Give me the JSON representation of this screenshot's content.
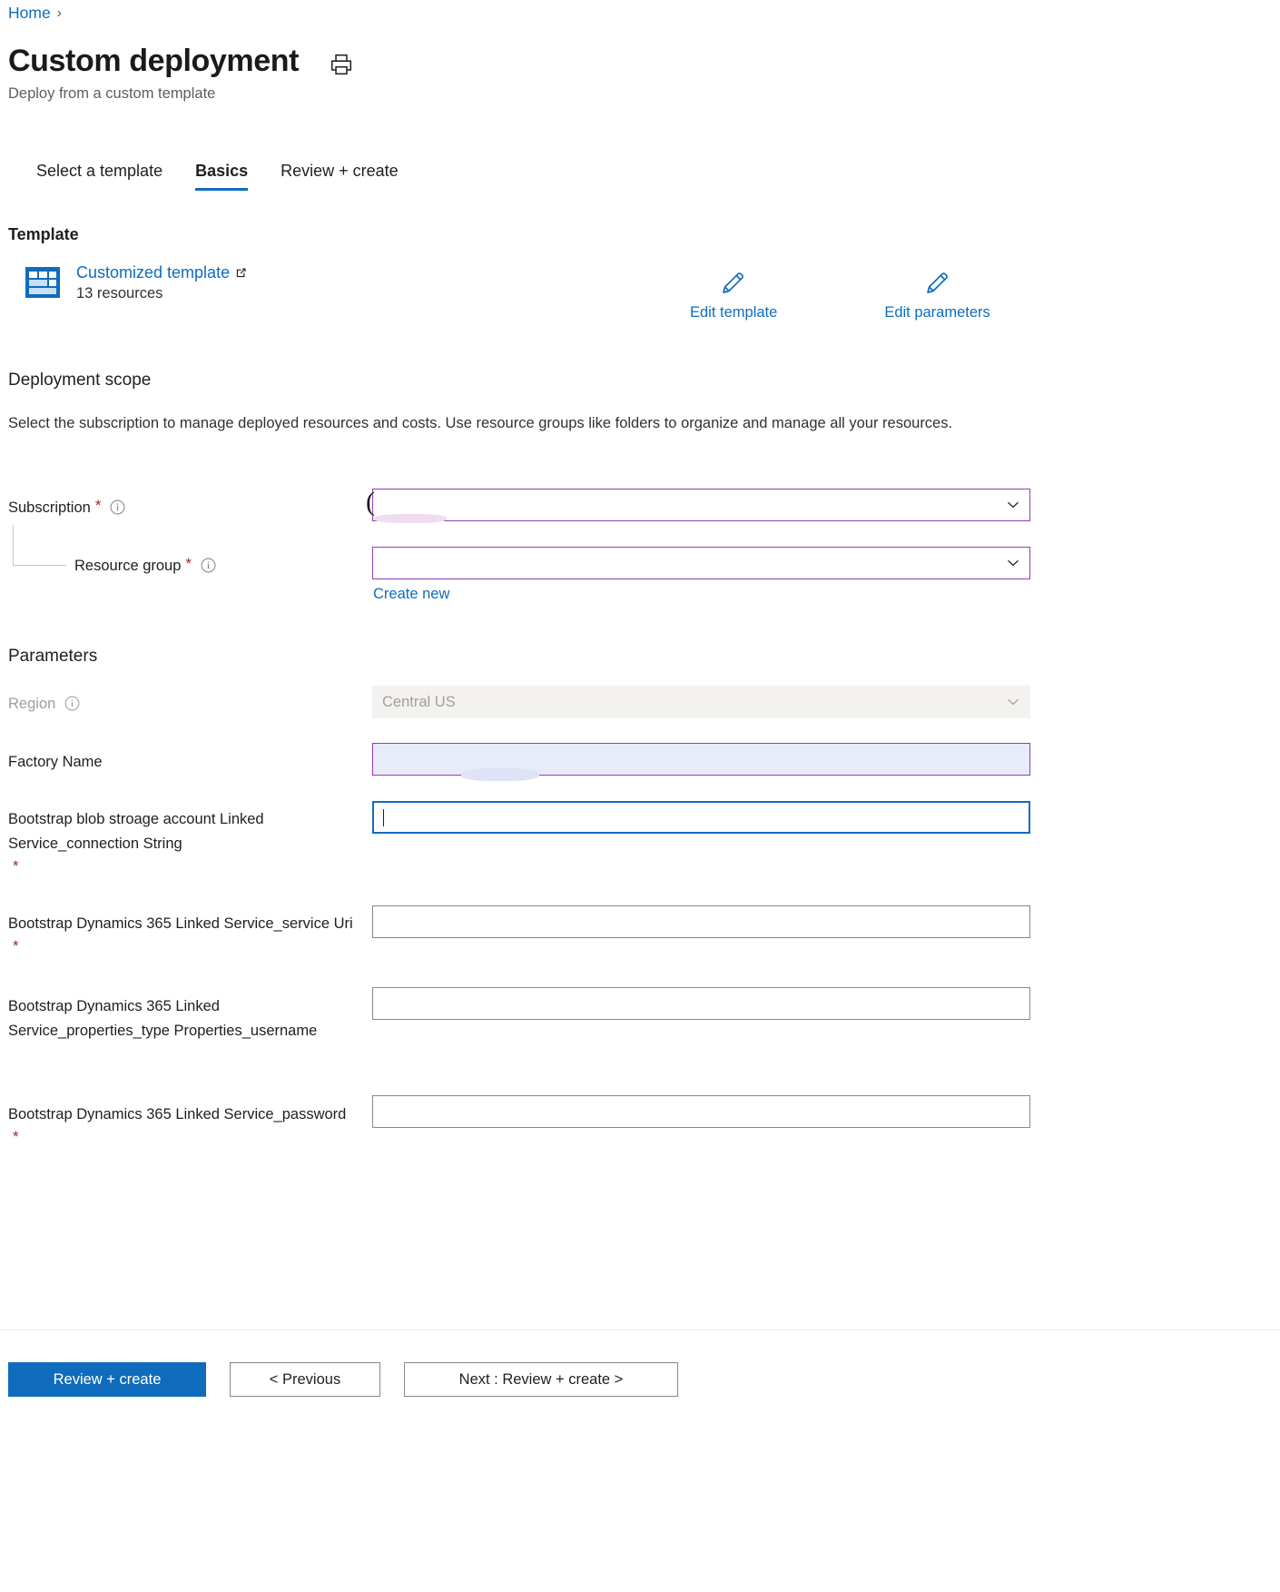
{
  "breadcrumb": {
    "home_label": "Home",
    "separator": "›"
  },
  "header": {
    "title": "Custom deployment",
    "subtitle": "Deploy from a custom template",
    "print_icon": "print-icon"
  },
  "tabs": [
    {
      "label": "Select a template",
      "active": false
    },
    {
      "label": "Basics",
      "active": true
    },
    {
      "label": "Review + create",
      "active": false
    }
  ],
  "template": {
    "heading": "Template",
    "icon": "template-grid-icon",
    "link_label": "Customized template",
    "external_icon": "open-in-new-icon",
    "resource_count": "13 resources",
    "actions": [
      {
        "label": "Edit template",
        "icon": "pencil-icon"
      },
      {
        "label": "Edit parameters",
        "icon": "pencil-icon"
      }
    ]
  },
  "deployment_scope": {
    "heading": "Deployment scope",
    "description": "Select the subscription to manage deployed resources and costs. Use resource groups like folders to organize and manage all your resources.",
    "subscription": {
      "label": "Subscription",
      "required_marker": "*",
      "info_icon": "info-icon",
      "value": "",
      "chevron_icon": "chevron-down-icon"
    },
    "resource_group": {
      "label": "Resource group",
      "required_marker": "*",
      "info_icon": "info-icon",
      "value": "",
      "chevron_icon": "chevron-down-icon",
      "create_new_label": "Create new"
    }
  },
  "parameters": {
    "heading": "Parameters",
    "fields": [
      {
        "label": "Region",
        "required": false,
        "has_info": true,
        "value": "Central US",
        "state": "readonly",
        "control": "dropdown"
      },
      {
        "label": "Factory Name",
        "required": false,
        "has_info": false,
        "value": "",
        "state": "highlight",
        "control": "text"
      },
      {
        "label": "Bootstrap blob stroage account Linked Service_connection String",
        "required": true,
        "has_info": false,
        "value": "",
        "state": "focused",
        "control": "text"
      },
      {
        "label": "Bootstrap Dynamics 365 Linked Service_service Uri",
        "required": true,
        "has_info": false,
        "value": "",
        "state": "normal",
        "control": "text"
      },
      {
        "label": "Bootstrap Dynamics 365 Linked Service_properties_type Properties_username",
        "required": false,
        "has_info": false,
        "value": "",
        "state": "normal",
        "control": "text"
      },
      {
        "label": "Bootstrap Dynamics 365 Linked Service_password",
        "required": true,
        "has_info": false,
        "value": "",
        "state": "normal",
        "control": "text"
      }
    ]
  },
  "footer": {
    "review_create_label": "Review + create",
    "previous_label": "< Previous",
    "next_label": "Next : Review + create >"
  },
  "colors": {
    "accent_blue": "#0f6cbd",
    "required_red": "#a4262c",
    "dropdown_purple": "#943cb4",
    "focus_blue": "#0f6cbd",
    "highlight_fill": "#e8ebfa",
    "readonly_fill": "#f3f2f1"
  }
}
